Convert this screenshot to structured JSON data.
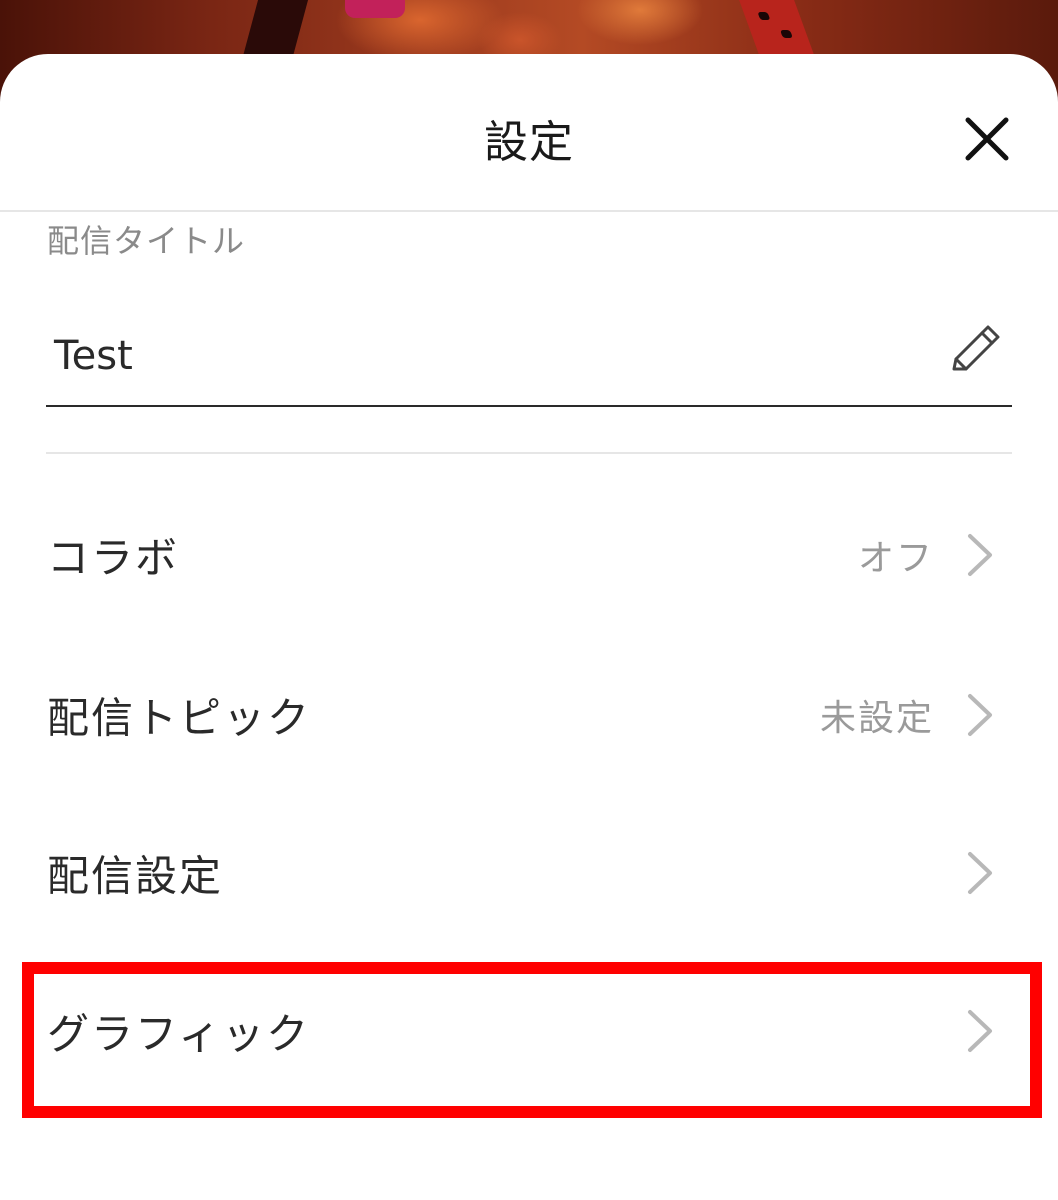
{
  "sheet": {
    "title": "設定"
  },
  "stream_title": {
    "label": "配信タイトル",
    "value": "Test"
  },
  "menu": {
    "collab": {
      "label": "コラボ",
      "value": "オフ"
    },
    "topic": {
      "label": "配信トピック",
      "value": "未設定"
    },
    "settings": {
      "label": "配信設定"
    },
    "graphics": {
      "label": "グラフィック"
    }
  },
  "colors": {
    "highlight": "#ff0000",
    "chevron": "#b8b8b8",
    "secondary_text": "#9a9a9a"
  },
  "icons": {
    "close": "close-icon",
    "edit": "pencil-icon",
    "chevron": "chevron-right-icon"
  }
}
